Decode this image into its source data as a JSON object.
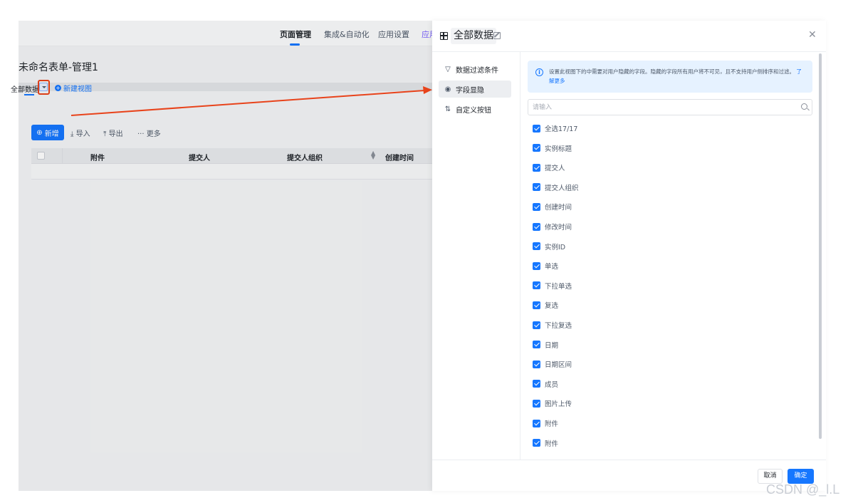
{
  "app": {
    "nav": [
      "页面管理",
      "集成&自动化",
      "应用设置",
      "应用"
    ],
    "form_title": "未命名表单-管理1",
    "view_tab": "全部数据",
    "new_view": "新建视图",
    "toolbar": {
      "new": "新增",
      "import": "导入",
      "export": "导出",
      "more": "更多"
    },
    "table_headers": [
      "附件",
      "提交人",
      "提交人组织",
      "创建时间"
    ]
  },
  "drawer": {
    "title": "全部数据",
    "side_items": [
      {
        "label": "数据过滤条件",
        "icon": "filter-icon"
      },
      {
        "label": "字段显隐",
        "icon": "eye-icon"
      },
      {
        "label": "自定义按钮",
        "icon": "sort-icon"
      }
    ],
    "info_text": "设置此视图下的中需要对用户隐藏的字段。隐藏的字段所有用户将不可见，且不支持用户侧排序和过滤。",
    "info_link": "了解更多",
    "search_placeholder": "请输入",
    "fields": [
      "全选17/17",
      "实例标题",
      "提交人",
      "提交人组织",
      "创建时间",
      "修改时间",
      "实例ID",
      "单选",
      "下拉单选",
      "复选",
      "下拉复选",
      "日期",
      "日期区间",
      "成员",
      "图片上传",
      "附件",
      "附件"
    ],
    "cancel": "取消",
    "ok": "确定"
  },
  "watermark": "CSDN @_l.L",
  "colors": {
    "primary": "#1677ff",
    "annotation_red": "#e8431b"
  }
}
